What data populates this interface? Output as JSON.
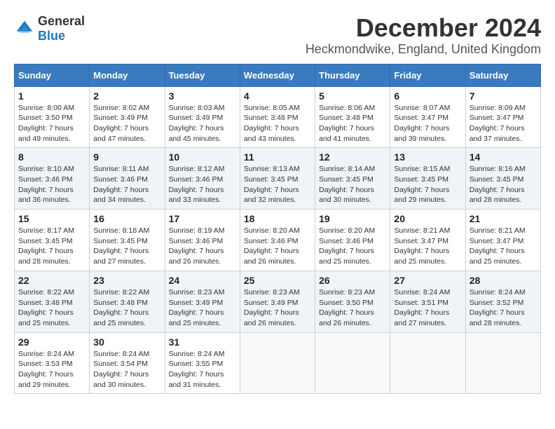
{
  "logo": {
    "text_general": "General",
    "text_blue": "Blue"
  },
  "title": "December 2024",
  "subtitle": "Heckmondwike, England, United Kingdom",
  "days_header": [
    "Sunday",
    "Monday",
    "Tuesday",
    "Wednesday",
    "Thursday",
    "Friday",
    "Saturday"
  ],
  "weeks": [
    [
      {
        "day": "1",
        "sunrise": "Sunrise: 8:00 AM",
        "sunset": "Sunset: 3:50 PM",
        "daylight": "Daylight: 7 hours and 49 minutes."
      },
      {
        "day": "2",
        "sunrise": "Sunrise: 8:02 AM",
        "sunset": "Sunset: 3:49 PM",
        "daylight": "Daylight: 7 hours and 47 minutes."
      },
      {
        "day": "3",
        "sunrise": "Sunrise: 8:03 AM",
        "sunset": "Sunset: 3:49 PM",
        "daylight": "Daylight: 7 hours and 45 minutes."
      },
      {
        "day": "4",
        "sunrise": "Sunrise: 8:05 AM",
        "sunset": "Sunset: 3:48 PM",
        "daylight": "Daylight: 7 hours and 43 minutes."
      },
      {
        "day": "5",
        "sunrise": "Sunrise: 8:06 AM",
        "sunset": "Sunset: 3:48 PM",
        "daylight": "Daylight: 7 hours and 41 minutes."
      },
      {
        "day": "6",
        "sunrise": "Sunrise: 8:07 AM",
        "sunset": "Sunset: 3:47 PM",
        "daylight": "Daylight: 7 hours and 39 minutes."
      },
      {
        "day": "7",
        "sunrise": "Sunrise: 8:09 AM",
        "sunset": "Sunset: 3:47 PM",
        "daylight": "Daylight: 7 hours and 37 minutes."
      }
    ],
    [
      {
        "day": "8",
        "sunrise": "Sunrise: 8:10 AM",
        "sunset": "Sunset: 3:46 PM",
        "daylight": "Daylight: 7 hours and 36 minutes."
      },
      {
        "day": "9",
        "sunrise": "Sunrise: 8:11 AM",
        "sunset": "Sunset: 3:46 PM",
        "daylight": "Daylight: 7 hours and 34 minutes."
      },
      {
        "day": "10",
        "sunrise": "Sunrise: 8:12 AM",
        "sunset": "Sunset: 3:46 PM",
        "daylight": "Daylight: 7 hours and 33 minutes."
      },
      {
        "day": "11",
        "sunrise": "Sunrise: 8:13 AM",
        "sunset": "Sunset: 3:45 PM",
        "daylight": "Daylight: 7 hours and 32 minutes."
      },
      {
        "day": "12",
        "sunrise": "Sunrise: 8:14 AM",
        "sunset": "Sunset: 3:45 PM",
        "daylight": "Daylight: 7 hours and 30 minutes."
      },
      {
        "day": "13",
        "sunrise": "Sunrise: 8:15 AM",
        "sunset": "Sunset: 3:45 PM",
        "daylight": "Daylight: 7 hours and 29 minutes."
      },
      {
        "day": "14",
        "sunrise": "Sunrise: 8:16 AM",
        "sunset": "Sunset: 3:45 PM",
        "daylight": "Daylight: 7 hours and 28 minutes."
      }
    ],
    [
      {
        "day": "15",
        "sunrise": "Sunrise: 8:17 AM",
        "sunset": "Sunset: 3:45 PM",
        "daylight": "Daylight: 7 hours and 28 minutes."
      },
      {
        "day": "16",
        "sunrise": "Sunrise: 8:18 AM",
        "sunset": "Sunset: 3:45 PM",
        "daylight": "Daylight: 7 hours and 27 minutes."
      },
      {
        "day": "17",
        "sunrise": "Sunrise: 8:19 AM",
        "sunset": "Sunset: 3:46 PM",
        "daylight": "Daylight: 7 hours and 26 minutes."
      },
      {
        "day": "18",
        "sunrise": "Sunrise: 8:20 AM",
        "sunset": "Sunset: 3:46 PM",
        "daylight": "Daylight: 7 hours and 26 minutes."
      },
      {
        "day": "19",
        "sunrise": "Sunrise: 8:20 AM",
        "sunset": "Sunset: 3:46 PM",
        "daylight": "Daylight: 7 hours and 25 minutes."
      },
      {
        "day": "20",
        "sunrise": "Sunrise: 8:21 AM",
        "sunset": "Sunset: 3:47 PM",
        "daylight": "Daylight: 7 hours and 25 minutes."
      },
      {
        "day": "21",
        "sunrise": "Sunrise: 8:21 AM",
        "sunset": "Sunset: 3:47 PM",
        "daylight": "Daylight: 7 hours and 25 minutes."
      }
    ],
    [
      {
        "day": "22",
        "sunrise": "Sunrise: 8:22 AM",
        "sunset": "Sunset: 3:48 PM",
        "daylight": "Daylight: 7 hours and 25 minutes."
      },
      {
        "day": "23",
        "sunrise": "Sunrise: 8:22 AM",
        "sunset": "Sunset: 3:48 PM",
        "daylight": "Daylight: 7 hours and 25 minutes."
      },
      {
        "day": "24",
        "sunrise": "Sunrise: 8:23 AM",
        "sunset": "Sunset: 3:49 PM",
        "daylight": "Daylight: 7 hours and 25 minutes."
      },
      {
        "day": "25",
        "sunrise": "Sunrise: 8:23 AM",
        "sunset": "Sunset: 3:49 PM",
        "daylight": "Daylight: 7 hours and 26 minutes."
      },
      {
        "day": "26",
        "sunrise": "Sunrise: 8:23 AM",
        "sunset": "Sunset: 3:50 PM",
        "daylight": "Daylight: 7 hours and 26 minutes."
      },
      {
        "day": "27",
        "sunrise": "Sunrise: 8:24 AM",
        "sunset": "Sunset: 3:51 PM",
        "daylight": "Daylight: 7 hours and 27 minutes."
      },
      {
        "day": "28",
        "sunrise": "Sunrise: 8:24 AM",
        "sunset": "Sunset: 3:52 PM",
        "daylight": "Daylight: 7 hours and 28 minutes."
      }
    ],
    [
      {
        "day": "29",
        "sunrise": "Sunrise: 8:24 AM",
        "sunset": "Sunset: 3:53 PM",
        "daylight": "Daylight: 7 hours and 29 minutes."
      },
      {
        "day": "30",
        "sunrise": "Sunrise: 8:24 AM",
        "sunset": "Sunset: 3:54 PM",
        "daylight": "Daylight: 7 hours and 30 minutes."
      },
      {
        "day": "31",
        "sunrise": "Sunrise: 8:24 AM",
        "sunset": "Sunset: 3:55 PM",
        "daylight": "Daylight: 7 hours and 31 minutes."
      },
      null,
      null,
      null,
      null
    ]
  ]
}
